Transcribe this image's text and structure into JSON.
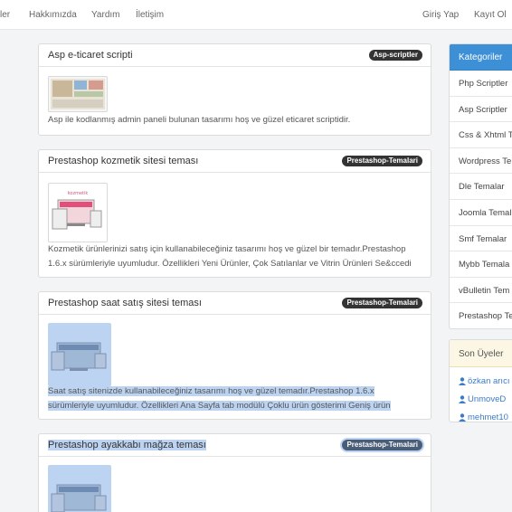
{
  "navbar": {
    "left_links": [
      "ler",
      "Hakkımızda",
      "Yardım",
      "İletişim"
    ],
    "right_links": [
      "Giriş Yap",
      "Kayıt Ol"
    ]
  },
  "posts": [
    {
      "title": "Asp e-ticaret scripti",
      "category": "Asp-scriptler",
      "lines": [
        "Asp ile kodlanmış admin paneli bulunan tasarımı hoş ve güzel eticaret scriptidir."
      ]
    },
    {
      "title": "Prestashop kozmetik sitesi teması",
      "category": "Prestashop-Temalari",
      "lines": [
        "Kozmetik ürünlerinizi satış için kullanabileceğiniz tasarımı hoş ve güzel bir temadır.Prestashop",
        "1.6.x sürümleriyle uyumludur. Özellikleri Yeni Ürünler, Çok Satılanlar ve Vitrin Ürünleri Se&ccedi"
      ]
    },
    {
      "title": "Prestashop saat satış sitesi teması",
      "category": "Prestashop-Temalari",
      "lines": [
        "Saat satış sitenizde kullanabileceğiniz tasarımı hoş ve güzel temadır.Prestashop 1.6.x",
        "sürümleriyle uyumludur. Özellikleri Ana Sayfa tab modülü Çoklu ürün gösterimi Geniş ürün"
      ]
    },
    {
      "title": "Prestashop ayakkabı mağza teması",
      "category": "Prestashop-Temalari",
      "lines": []
    }
  ],
  "categories": {
    "header": "Kategoriler",
    "items": [
      "Php Scriptler",
      "Asp Scriptler",
      "Css & Xhtml T",
      "Wordpress Te",
      "Dle Temalar",
      "Joomla Temal",
      "Smf Temalar",
      "Mybb Temala",
      "vBulletin Tem",
      "Prestashop Te"
    ]
  },
  "members": {
    "header": "Son Üyeler",
    "items": [
      "özkan arıcı",
      "UnmoveD",
      "mehmet10"
    ]
  },
  "colors": {
    "accent": "#3d8fd6",
    "badge": "#333333",
    "selection": "#bcd4f2",
    "members_bg": "#fcf7e4"
  }
}
